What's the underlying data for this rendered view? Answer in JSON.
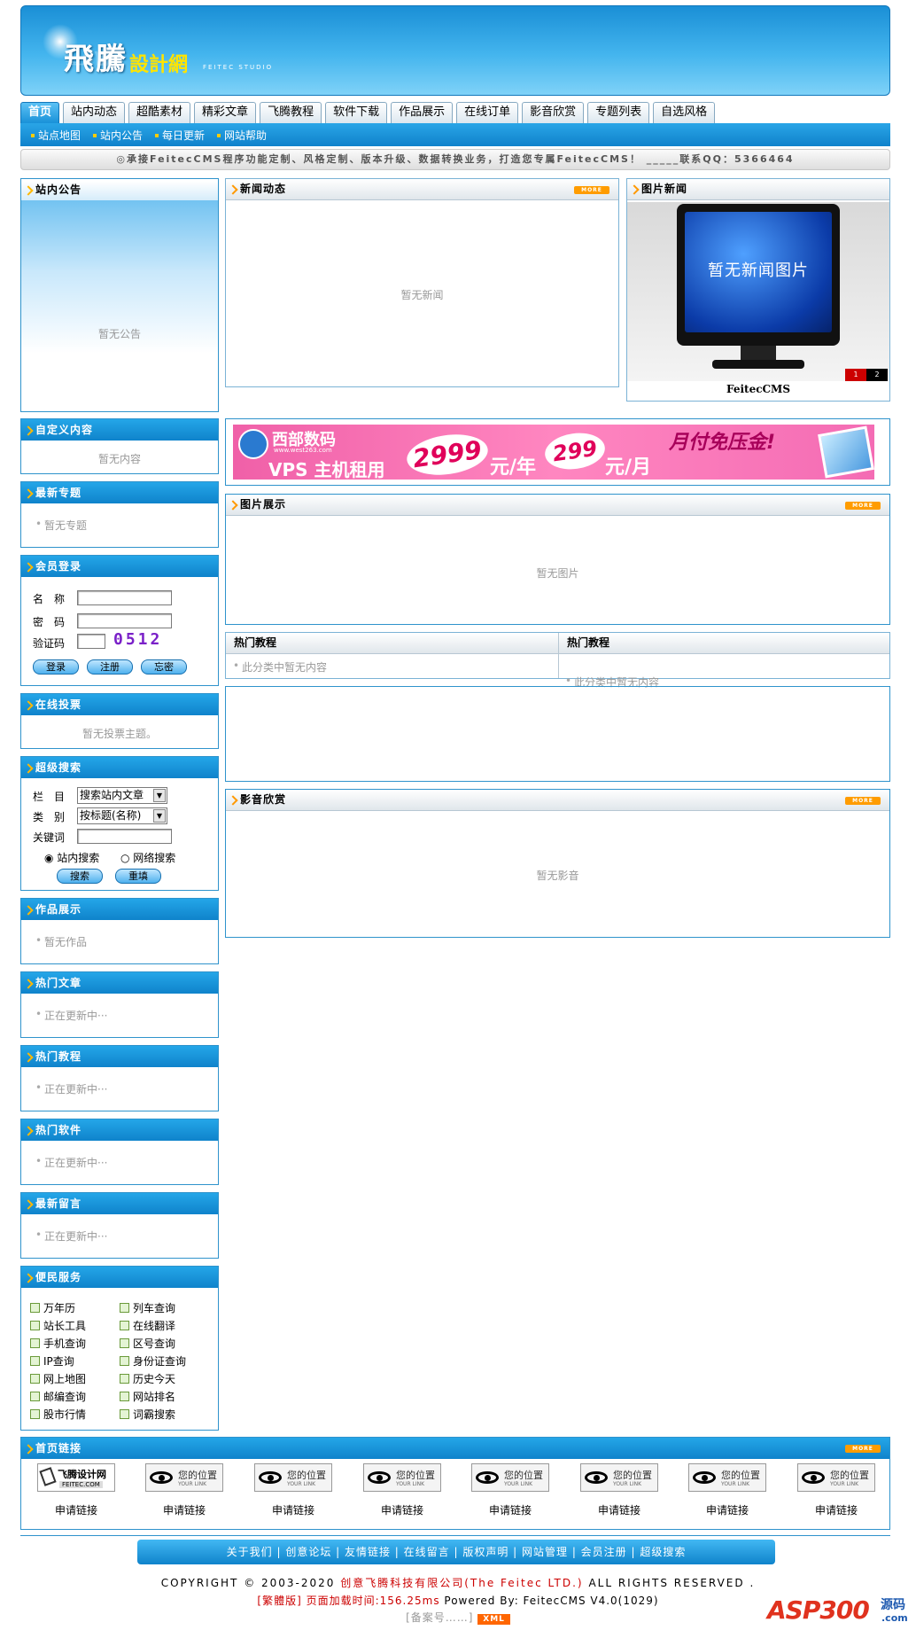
{
  "header": {
    "logo_main": "飛騰",
    "logo_sub": "設計網",
    "logo_en": "FEITEC STUDIO"
  },
  "nav": {
    "tabs": [
      "首页",
      "站内动态",
      "超酷素材",
      "精彩文章",
      "飞腾教程",
      "软件下载",
      "作品展示",
      "在线订单",
      "影音欣赏",
      "专题列表",
      "自选风格"
    ]
  },
  "subnav": {
    "items": [
      "站点地图",
      "站内公告",
      "每日更新",
      "网站帮助"
    ]
  },
  "marquee": "◎承接FeitecCMS程序功能定制、风格定制、版本升级、数据转换业务，打造您专属FeitecCMS！ _____联系QQ：5366464",
  "notice": {
    "title": "站内公告",
    "empty": "暂无公告"
  },
  "news": {
    "title": "新闻动态",
    "more": "MORE",
    "empty": "暂无新闻"
  },
  "photo_news": {
    "title": "图片新闻",
    "screen_text": "暂无新闻图片",
    "caption": "FeitecCMS",
    "pages": [
      "1",
      "2"
    ]
  },
  "custom": {
    "title": "自定义内容",
    "empty": "暂无内容"
  },
  "special": {
    "title": "最新专题",
    "item": "暂无专题"
  },
  "banner": {
    "brand": "西部数码",
    "brand_url": "www.west263.com",
    "headline": "VPS 主机租用",
    "price_year": "2999",
    "unit_year": "元/年",
    "price_month": "299",
    "unit_month": "元/月",
    "promo": "月付免压金!"
  },
  "pics": {
    "title": "图片展示",
    "more": "MORE",
    "empty": "暂无图片"
  },
  "hot_tut": {
    "col1_title": "热门教程",
    "col2_title": "热门教程",
    "col1_item": "此分类中暂无内容",
    "col2_item": "此分类中暂无内容"
  },
  "login": {
    "title": "会员登录",
    "name_label": "名　称",
    "pwd_label": "密　码",
    "code_label": "验证码",
    "captcha": "0512",
    "btn_login": "登录",
    "btn_reg": "注册",
    "btn_forgot": "忘密"
  },
  "vote": {
    "title": "在线投票",
    "empty": "暂无投票主题。"
  },
  "search": {
    "title": "超级搜索",
    "col_label": "栏　目",
    "col_value": "搜索站内文章",
    "type_label": "类　别",
    "type_value": "按标题(名称)",
    "kw_label": "关键词",
    "radio1": "站内搜索",
    "radio2": "网络搜索",
    "btn_search": "搜索",
    "btn_reset": "重填"
  },
  "media": {
    "title": "影音欣赏",
    "more": "MORE",
    "empty": "暂无影音"
  },
  "works": {
    "title": "作品展示",
    "item": "暂无作品"
  },
  "hot_article": {
    "title": "热门文章",
    "item": "正在更新中···"
  },
  "hot_tutorial": {
    "title": "热门教程",
    "item": "正在更新中···"
  },
  "hot_soft": {
    "title": "热门软件",
    "item": "正在更新中···"
  },
  "new_msg": {
    "title": "最新留言",
    "item": "正在更新中···"
  },
  "services": {
    "title": "便民服务",
    "left": [
      "万年历",
      "站长工具",
      "手机查询",
      "IP查询",
      "网上地图",
      "邮编查询",
      "股市行情"
    ],
    "right": [
      "列车查询",
      "在线翻译",
      "区号查询",
      "身份证查询",
      "历史今天",
      "网站排名",
      "词霸搜索"
    ]
  },
  "links": {
    "title": "首页链接",
    "more": "MORE",
    "first_logo": "飞腾设计网",
    "first_logo_en": "FEITEC.COM",
    "slot_text": "您的位置",
    "slot_en": "YOUR LINK",
    "apply": "申请链接"
  },
  "footer": {
    "nav": "关于我们 | 创意论坛 | 友情链接 | 在线留言 | 版权声明 | 网站管理 | 会员注册 | 超级搜索",
    "copy_a": "COPYRIGHT © 2003-2020 ",
    "copy_company": "创意飞腾科技有限公司(The Feitec LTD.)",
    "copy_b": " ALL RIGHTS RESERVED .",
    "trad": "[繁體版]",
    "load": " 页面加载时间:156.25ms ",
    "powered": "Powered By: FeitecCMS V4.0(1029)",
    "icp": "[备案号……]",
    "xml": "XML",
    "watermark": "ASP300",
    "watermark_cn": "源码",
    "watermark_com": ".com"
  }
}
